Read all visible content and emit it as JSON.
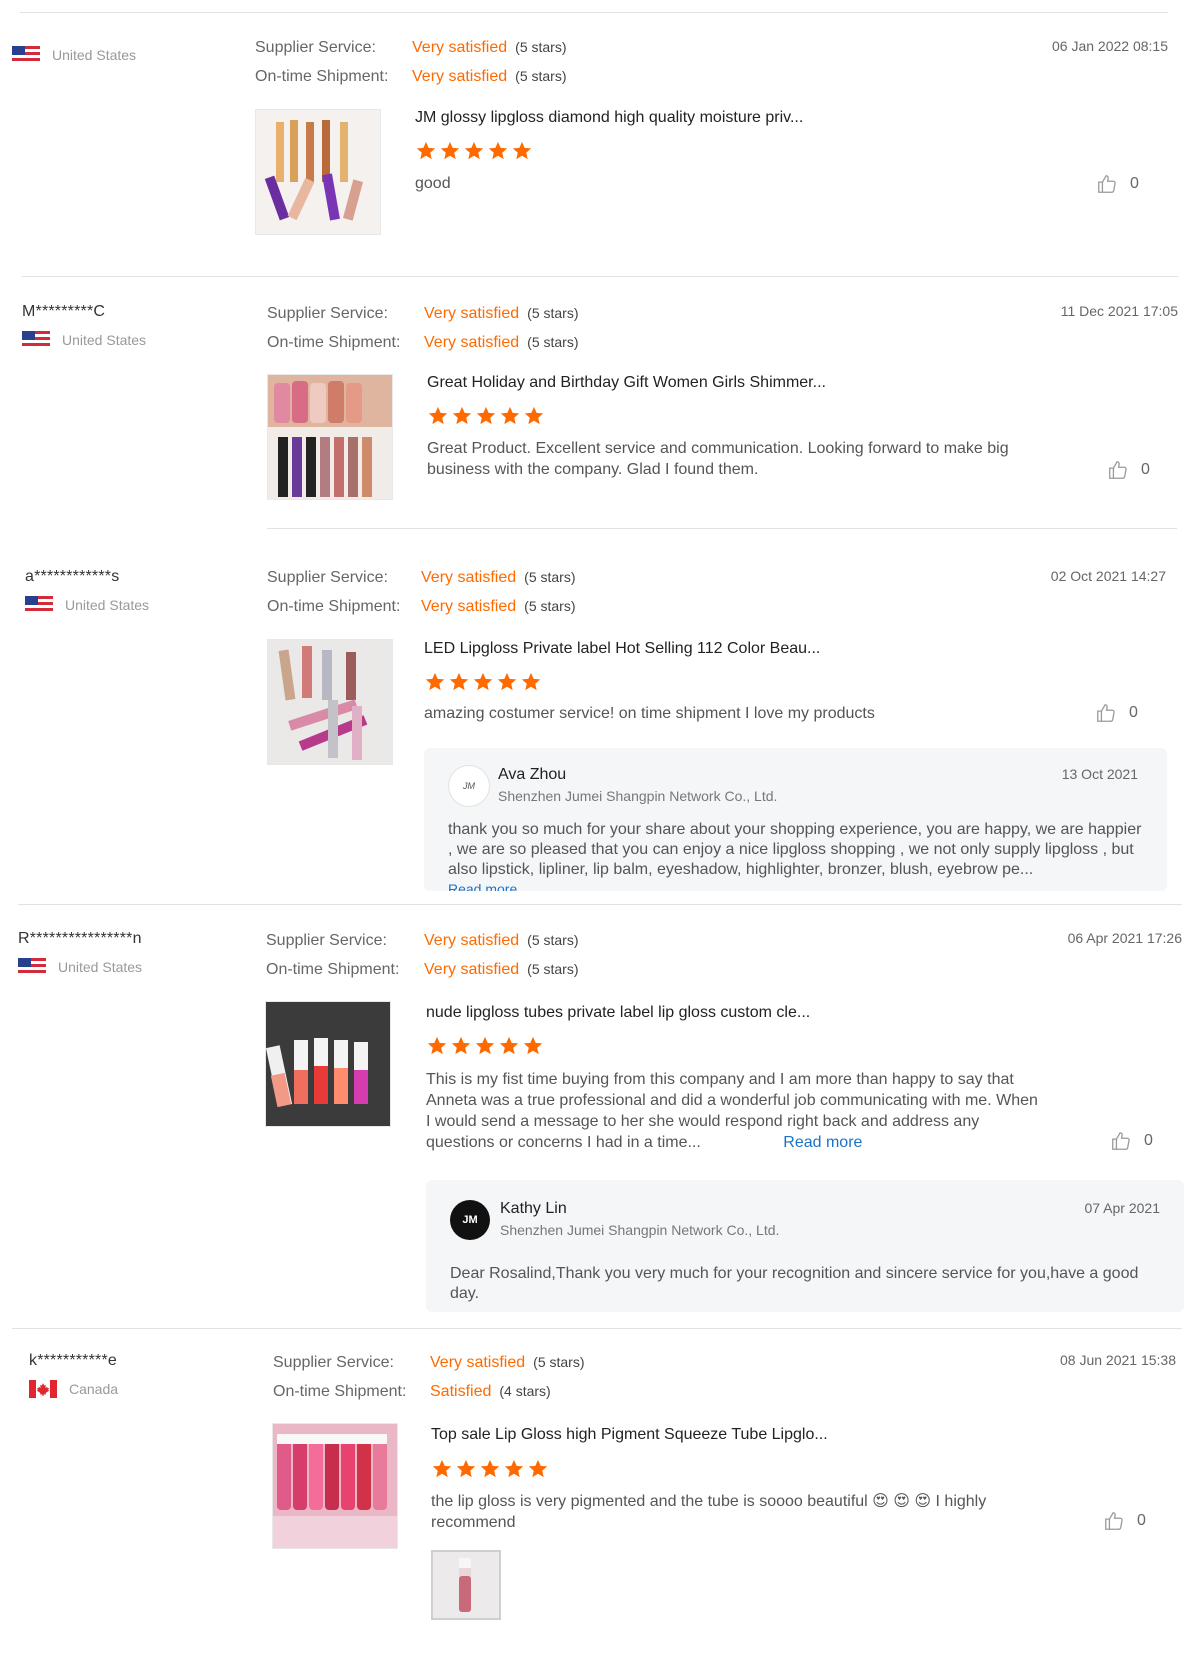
{
  "reviews": [
    {
      "username": "",
      "country": "United States",
      "supplier_label": "Supplier Service:",
      "supplier_value": "Very satisfied",
      "supplier_stars": "(5 stars)",
      "shipment_label": "On-time Shipment:",
      "shipment_value": "Very satisfied",
      "shipment_stars": "(5 stars)",
      "date": "06 Jan 2022 08:15",
      "product": "JM glossy lipgloss diamond high quality moisture priv...",
      "rating": 5,
      "text": "good",
      "likes": "0"
    },
    {
      "username": "M*********C",
      "country": "United States",
      "supplier_label": "Supplier Service:",
      "supplier_value": "Very satisfied",
      "supplier_stars": "(5 stars)",
      "shipment_label": "On-time Shipment:",
      "shipment_value": "Very satisfied",
      "shipment_stars": "(5 stars)",
      "date": "11 Dec 2021 17:05",
      "product": "Great Holiday and Birthday Gift Women Girls Shimmer...",
      "rating": 5,
      "text": "Great Product. Excellent service and communication. Looking forward to make big business with the company. Glad I found them.",
      "likes": "0"
    },
    {
      "username": "a************s",
      "country": "United States",
      "supplier_label": "Supplier Service:",
      "supplier_value": "Very satisfied",
      "supplier_stars": "(5 stars)",
      "shipment_label": "On-time Shipment:",
      "shipment_value": "Very satisfied",
      "shipment_stars": "(5 stars)",
      "date": "02 Oct 2021 14:27",
      "product": "LED Lipgloss Private label Hot Selling 112 Color Beau...",
      "rating": 5,
      "text": "amazing costumer service! on time shipment I love my products",
      "likes": "0",
      "reply": {
        "name": "Ava Zhou",
        "company": "Shenzhen Jumei Shangpin Network Co., Ltd.",
        "date": "13 Oct 2021",
        "text": "thank you so much for your share about your shopping experience, you are happy, we are happier , we are so pleased that you can enjoy a nice lipgloss shopping , we not only supply lipgloss , but also lipstick, lipliner, lip balm, eyeshadow, highlighter, bronzer, blush, eyebrow pe...",
        "read_more": "Read more"
      }
    },
    {
      "username": "R****************n",
      "country": "United States",
      "supplier_label": "Supplier Service:",
      "supplier_value": "Very satisfied",
      "supplier_stars": "(5 stars)",
      "shipment_label": "On-time Shipment:",
      "shipment_value": "Very satisfied",
      "shipment_stars": "(5 stars)",
      "date": "06 Apr 2021 17:26",
      "product": "nude lipgloss tubes private label lip gloss custom cle...",
      "rating": 5,
      "text": "This is my fist time buying from this company and I am more than happy to say that Anneta was a true professional and did a wonderful job communicating  with me.  When I would send a message to her she would respond right back and address any questions or concerns I had in a time...",
      "read_more": "Read more",
      "likes": "0",
      "reply": {
        "name": "Kathy Lin",
        "company": "Shenzhen Jumei Shangpin Network Co., Ltd.",
        "date": "07 Apr 2021",
        "avatar": "JM",
        "text": "Dear Rosalind,Thank you very much for your recognition and sincere service for you,have  a good day."
      }
    },
    {
      "username": "k***********e",
      "country": "Canada",
      "supplier_label": "Supplier Service:",
      "supplier_value": "Very satisfied",
      "supplier_stars": "(5 stars)",
      "shipment_label": "On-time Shipment:",
      "shipment_value": "Satisfied",
      "shipment_stars": "(4 stars)",
      "date": "08 Jun 2021 15:38",
      "product": "Top sale Lip Gloss high Pigment Squeeze Tube Lipglo...",
      "rating": 5,
      "text": "the lip gloss is very pigmented and the tube is soooo beautiful 😍 😍 😍  I highly recommend",
      "likes": "0"
    }
  ],
  "colors": {
    "accent": "#ff6a00",
    "star": "#ff6a00",
    "link": "#1a73c9",
    "divider": "#e2e2e2",
    "reply_bg": "#f5f6f7"
  },
  "icons": {
    "like": "thumbs-up-icon",
    "flag_us": "us-flag-icon",
    "flag_ca": "canada-flag-icon"
  }
}
